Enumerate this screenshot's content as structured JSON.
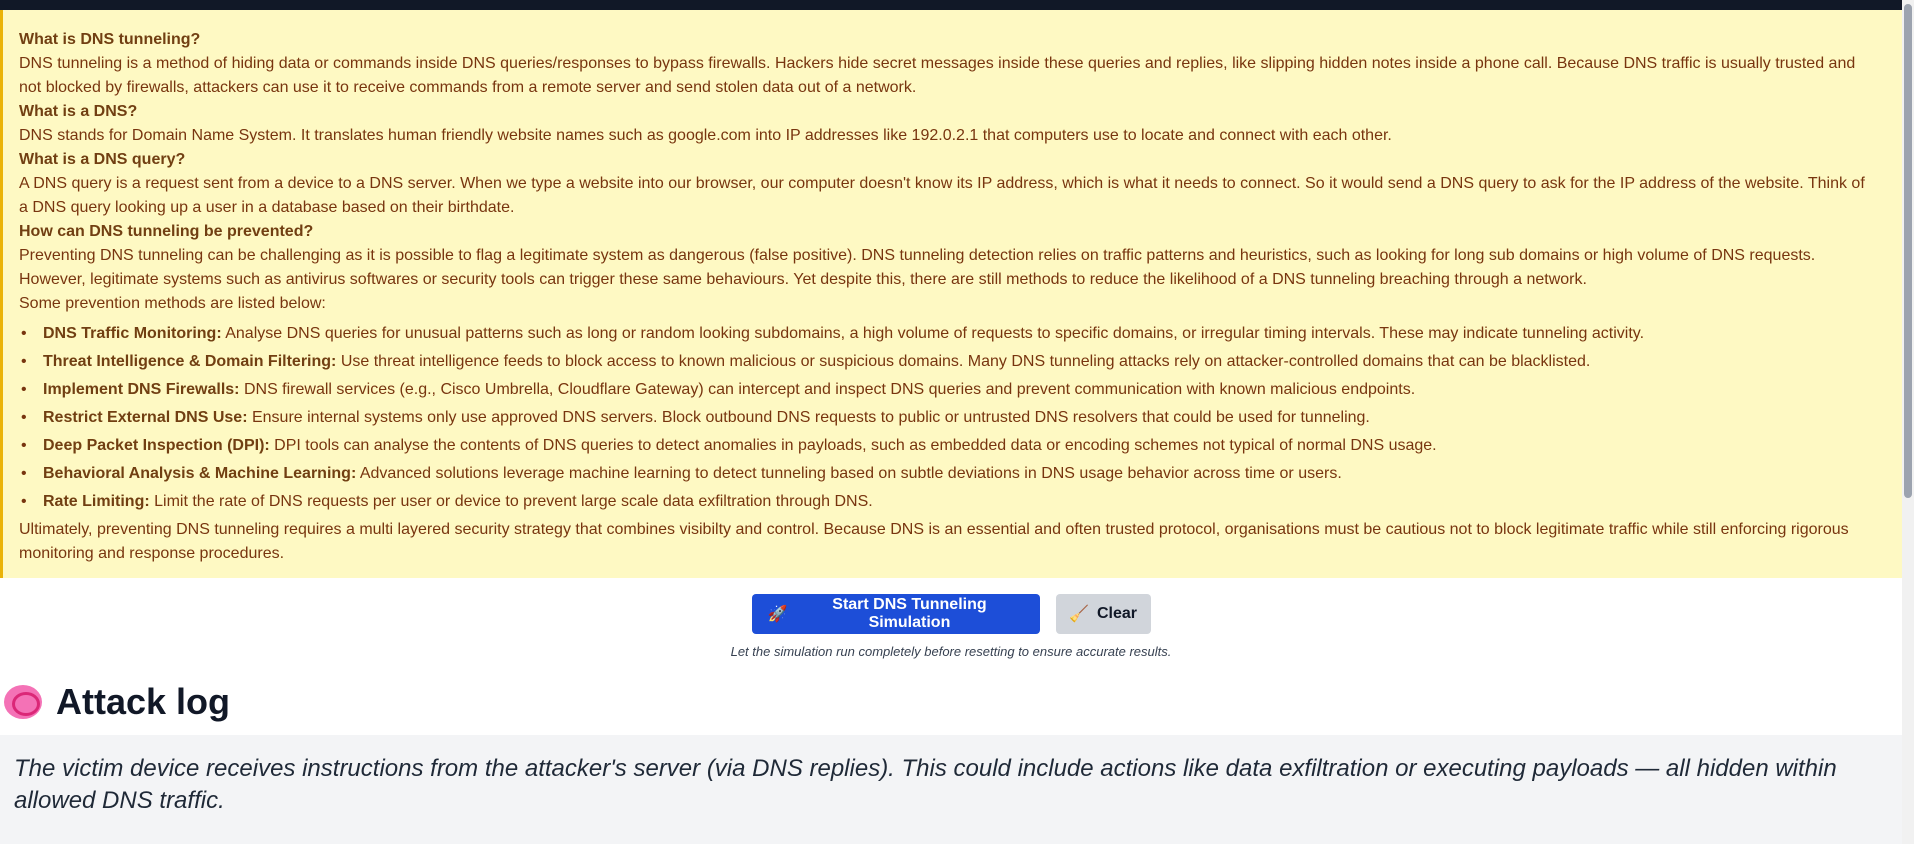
{
  "info": {
    "q1": "What is DNS tunneling?",
    "a1": "DNS tunneling is a method of hiding data or commands inside DNS queries/responses to bypass firewalls. Hackers hide secret messages inside these queries and replies, like slipping hidden notes inside a phone call. Because DNS traffic is usually trusted and not blocked by firewalls, attackers can use it to receive commands from a remote server and send stolen data out of a network.",
    "q2": "What is a DNS?",
    "a2": "DNS stands for Domain Name System. It translates human friendly website names such as google.com into IP addresses like 192.0.2.1 that computers use to locate and connect with each other.",
    "q3": "What is a DNS query?",
    "a3": "A DNS query is a request sent from a device to a DNS server. When we type a website into our browser, our computer doesn't know its IP address, which is what it needs to connect. So it would send a DNS query to ask for the IP address of the website. Think of a DNS query looking up a user in a database based on their birthdate.",
    "q4": "How can DNS tunneling be prevented?",
    "a4": "Preventing DNS tunneling can be challenging as it is possible to flag a legitimate system as dangerous (false positive). DNS tunneling detection relies on traffic patterns and heuristics, such as looking for long sub domains or high volume of DNS requests. However, legitimate systems such as antivirus softwares or security tools can trigger these same behaviours. Yet despite this, there are still methods to reduce the likelihood of a DNS tunneling breaching through a network.",
    "list_intro": "Some prevention methods are listed below:",
    "methods": [
      {
        "title": "DNS Traffic Monitoring:",
        "text": "Analyse DNS queries for unusual patterns such as long or random looking subdomains, a high volume of requests to specific domains, or irregular timing intervals. These may indicate tunneling activity."
      },
      {
        "title": "Threat Intelligence & Domain Filtering:",
        "text": "Use threat intelligence feeds to block access to known malicious or suspicious domains. Many DNS tunneling attacks rely on attacker-controlled domains that can be blacklisted."
      },
      {
        "title": "Implement DNS Firewalls:",
        "text": "DNS firewall services (e.g., Cisco Umbrella, Cloudflare Gateway) can intercept and inspect DNS queries and prevent communication with known malicious endpoints."
      },
      {
        "title": "Restrict External DNS Use:",
        "text": "Ensure internal systems only use approved DNS servers. Block outbound DNS requests to public or untrusted DNS resolvers that could be used for tunneling."
      },
      {
        "title": "Deep Packet Inspection (DPI):",
        "text": "DPI tools can analyse the contents of DNS queries to detect anomalies in payloads, such as embedded data or encoding schemes not typical of normal DNS usage."
      },
      {
        "title": "Behavioral Analysis & Machine Learning:",
        "text": "Advanced solutions leverage machine learning to detect tunneling based on subtle deviations in DNS usage behavior across time or users."
      },
      {
        "title": "Rate Limiting:",
        "text": "Limit the rate of DNS requests per user or device to prevent large scale data exfiltration through DNS."
      }
    ],
    "conclusion": "Ultimately, preventing DNS tunneling requires a multi layered security strategy that combines visibilty and control. Because DNS is an essential and often trusted protocol, organisations must be cautious not to block legitimate traffic while still enforcing rigorous monitoring and response procedures."
  },
  "buttons": {
    "start_icon": "🚀",
    "start_label": "Start DNS Tunneling Simulation",
    "clear_icon": "🧹",
    "clear_label": "Clear"
  },
  "hint": "Let the simulation run completely before resetting to ensure accurate results.",
  "attack_log": {
    "icon": "brain-icon",
    "title": "Attack log",
    "message": "The victim device receives instructions from the attacker's server (via DNS replies). This could include actions like data exfiltration or executing payloads — all hidden within allowed DNS traffic."
  },
  "colors": {
    "panel_bg": "#fef9c3",
    "panel_text": "#78350f",
    "primary_button": "#1d4ed8",
    "secondary_button": "#d1d5db"
  }
}
